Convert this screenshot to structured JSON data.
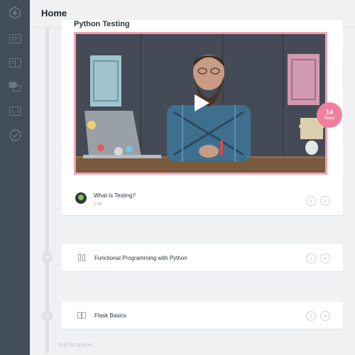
{
  "header": {
    "title": "Home"
  },
  "sidebar": {
    "icons": [
      "logo-icon",
      "tracks-icon",
      "library-icon",
      "community-icon",
      "workspaces-icon",
      "completed-icon"
    ]
  },
  "course": {
    "title": "Python Testing",
    "steps_count": "14",
    "steps_label": "Steps",
    "current_step": {
      "title": "What Is Testing?",
      "duration": "1:54"
    }
  },
  "queue": {
    "items": [
      {
        "label": "Functional Programming with Python",
        "icon": "track-icon"
      },
      {
        "label": "Flask Basics",
        "icon": "book-icon"
      }
    ],
    "add_placeholder": "Add to queue..."
  },
  "colors": {
    "sidebar": "#414d58",
    "accent": "#f07f9d",
    "video_border": "#f0a3b6"
  }
}
